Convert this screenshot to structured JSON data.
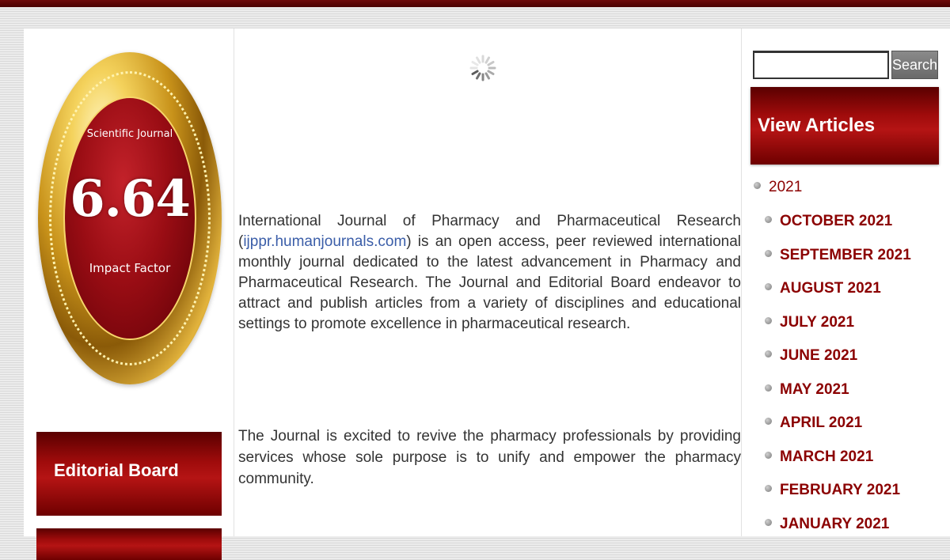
{
  "badge": {
    "top_text": "Scientific Journal",
    "value": "6.64",
    "bottom_text": "Impact Factor"
  },
  "sidebar": {
    "editorial_board_label": "Editorial Board"
  },
  "main": {
    "intro_before_link": "International Journal of Pharmacy and Pharmaceutical Research (",
    "intro_link": "ijppr.humanjournals.com",
    "intro_after_link": ") is an open access, peer reviewed international monthly journal dedicated to the latest advancement in Pharmacy and Pharmaceutical Research. The Journal and Editorial Board endeavor to attract and publish articles from a variety of disciplines and educational settings to promote excellence in pharmaceutical research.",
    "mission": "The Journal is excited to revive the pharmacy professionals by providing services whose sole purpose is to unify and empower the pharmacy community."
  },
  "search": {
    "placeholder": "",
    "button_label": "Search"
  },
  "articles": {
    "header": "View Articles",
    "year": "2021",
    "months": [
      "OCTOBER 2021",
      "SEPTEMBER 2021",
      "AUGUST 2021",
      "JULY 2021",
      "JUNE 2021",
      "MAY 2021",
      "APRIL 2021",
      "MARCH 2021",
      "FEBRUARY 2021",
      "JANUARY 2021"
    ]
  },
  "colors": {
    "brand_maroon": "#8b0000",
    "link_blue": "#3a5da8",
    "gold": "#d4a72c"
  },
  "icons": {
    "loading": "loading-spinner-icon",
    "bullet": "bullet-icon"
  }
}
